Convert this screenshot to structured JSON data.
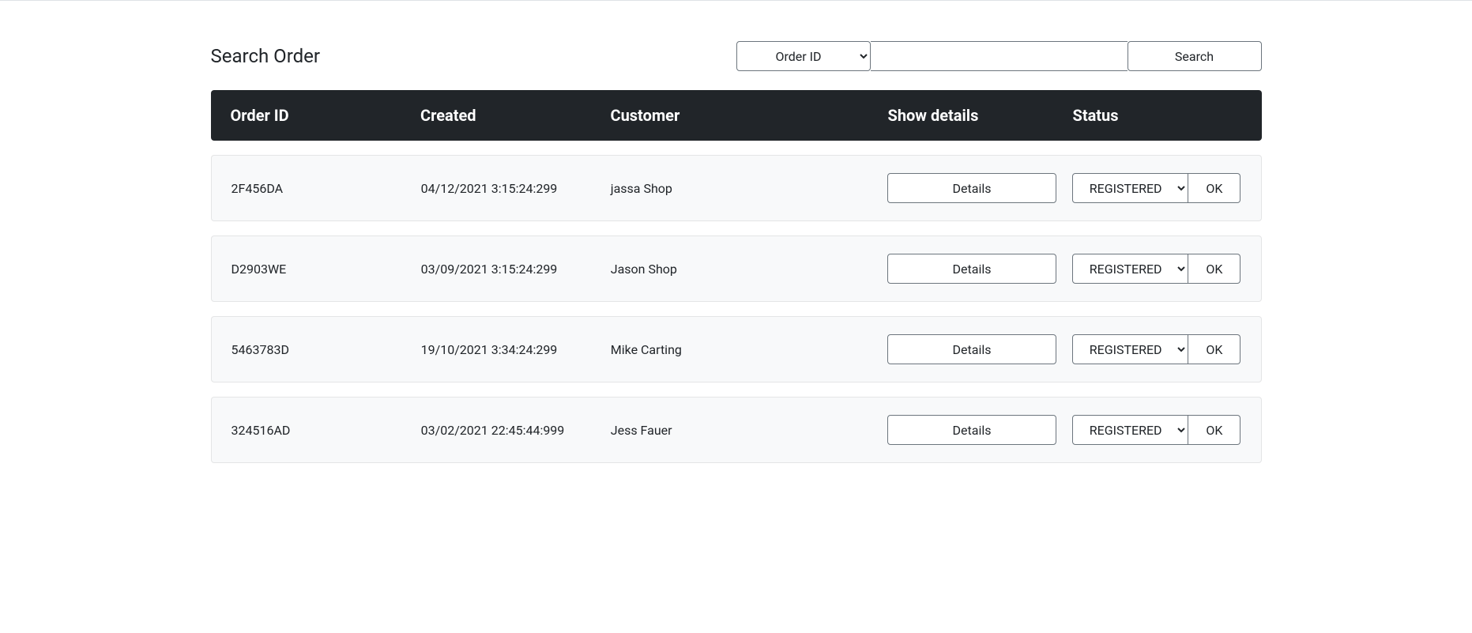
{
  "search": {
    "title": "Search Order",
    "filter_selected": "Order ID",
    "filter_options": [
      "Order ID"
    ],
    "input_value": "",
    "button_label": "Search"
  },
  "table": {
    "headers": {
      "order_id": "Order ID",
      "created": "Created",
      "customer": "Customer",
      "show_details": "Show details",
      "status": "Status"
    },
    "details_button_label": "Details",
    "ok_button_label": "OK",
    "status_options": [
      "REGISTERED"
    ],
    "rows": [
      {
        "order_id": "2F456DA",
        "created": "04/12/2021 3:15:24:299",
        "customer": "jassa Shop",
        "status": "REGISTERED"
      },
      {
        "order_id": "D2903WE",
        "created": "03/09/2021 3:15:24:299",
        "customer": "Jason Shop",
        "status": "REGISTERED"
      },
      {
        "order_id": "5463783D",
        "created": "19/10/2021 3:34:24:299",
        "customer": "Mike Carting",
        "status": "REGISTERED"
      },
      {
        "order_id": "324516AD",
        "created": "03/02/2021 22:45:44:999",
        "customer": "Jess Fauer",
        "status": "REGISTERED"
      }
    ]
  }
}
